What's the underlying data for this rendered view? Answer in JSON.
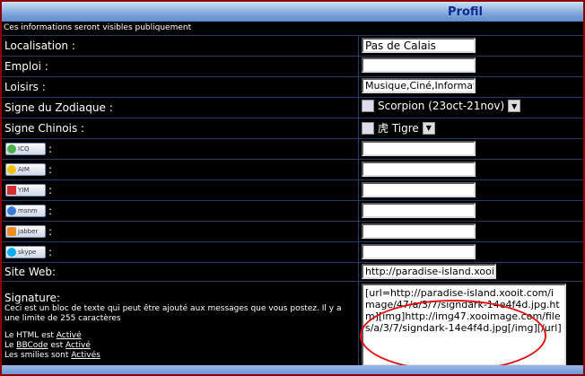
{
  "header": {
    "title": "Profil"
  },
  "notice": "Ces informations seront visibles publiquement",
  "fields": {
    "localisation": {
      "label": "Localisation :",
      "value": "Pas de Calais"
    },
    "emploi": {
      "label": "Emploi :",
      "value": ""
    },
    "loisirs": {
      "label": "Loisirs :",
      "value": "Musique,Ciné,Informati"
    },
    "zodiaque": {
      "label": "Signe du Zodiaque :",
      "value": "Scorpion (23oct-21nov)"
    },
    "chinois": {
      "label": "Signe Chinois :",
      "value": "虎 Tigre"
    },
    "icq": {
      "badge": "ICQ",
      "colon": ":",
      "value": ""
    },
    "aim": {
      "badge": "AIM",
      "colon": ":",
      "value": ""
    },
    "yim": {
      "badge": "YIM",
      "colon": ":",
      "value": ""
    },
    "msnm": {
      "badge": "msnm",
      "colon": ":",
      "value": ""
    },
    "jabber": {
      "badge": "jabber",
      "colon": ":",
      "value": ""
    },
    "skype": {
      "badge": "skype",
      "colon": ":",
      "value": ""
    },
    "siteweb": {
      "label": "Site Web:",
      "value": "http://paradise-island.xooit"
    }
  },
  "signature": {
    "label": "Signature:",
    "description": "Ceci est un bloc de texte qui peut être ajouté aux messages que vous postez. Il y a une limite de 255 caractères",
    "value": "[url=http://paradise-island.xooit.com/image/47/a/3/7/signdark-14e4f4d.jpg.htm][img]http://img47.xooimage.com/files/a/3/7/signdark-14e4f4d.jpg[/img][/url]",
    "html_prefix": "Le HTML est",
    "html_status": "Activé",
    "bbcode_prefix": "Le",
    "bbcode_link": "BBCode",
    "bbcode_mid": "est",
    "bbcode_status": "Activé",
    "smilies_prefix": "Les smilies sont",
    "smilies_status": "Activés"
  },
  "icons": {
    "zodiac": "scorpion-icon",
    "chinese": "tiger-icon",
    "dropdown": "chevron-down-icon"
  },
  "colors": {
    "background": "#000000",
    "header": "#7fa6dc",
    "label": "#ffffff",
    "highlight": "#e01010"
  }
}
